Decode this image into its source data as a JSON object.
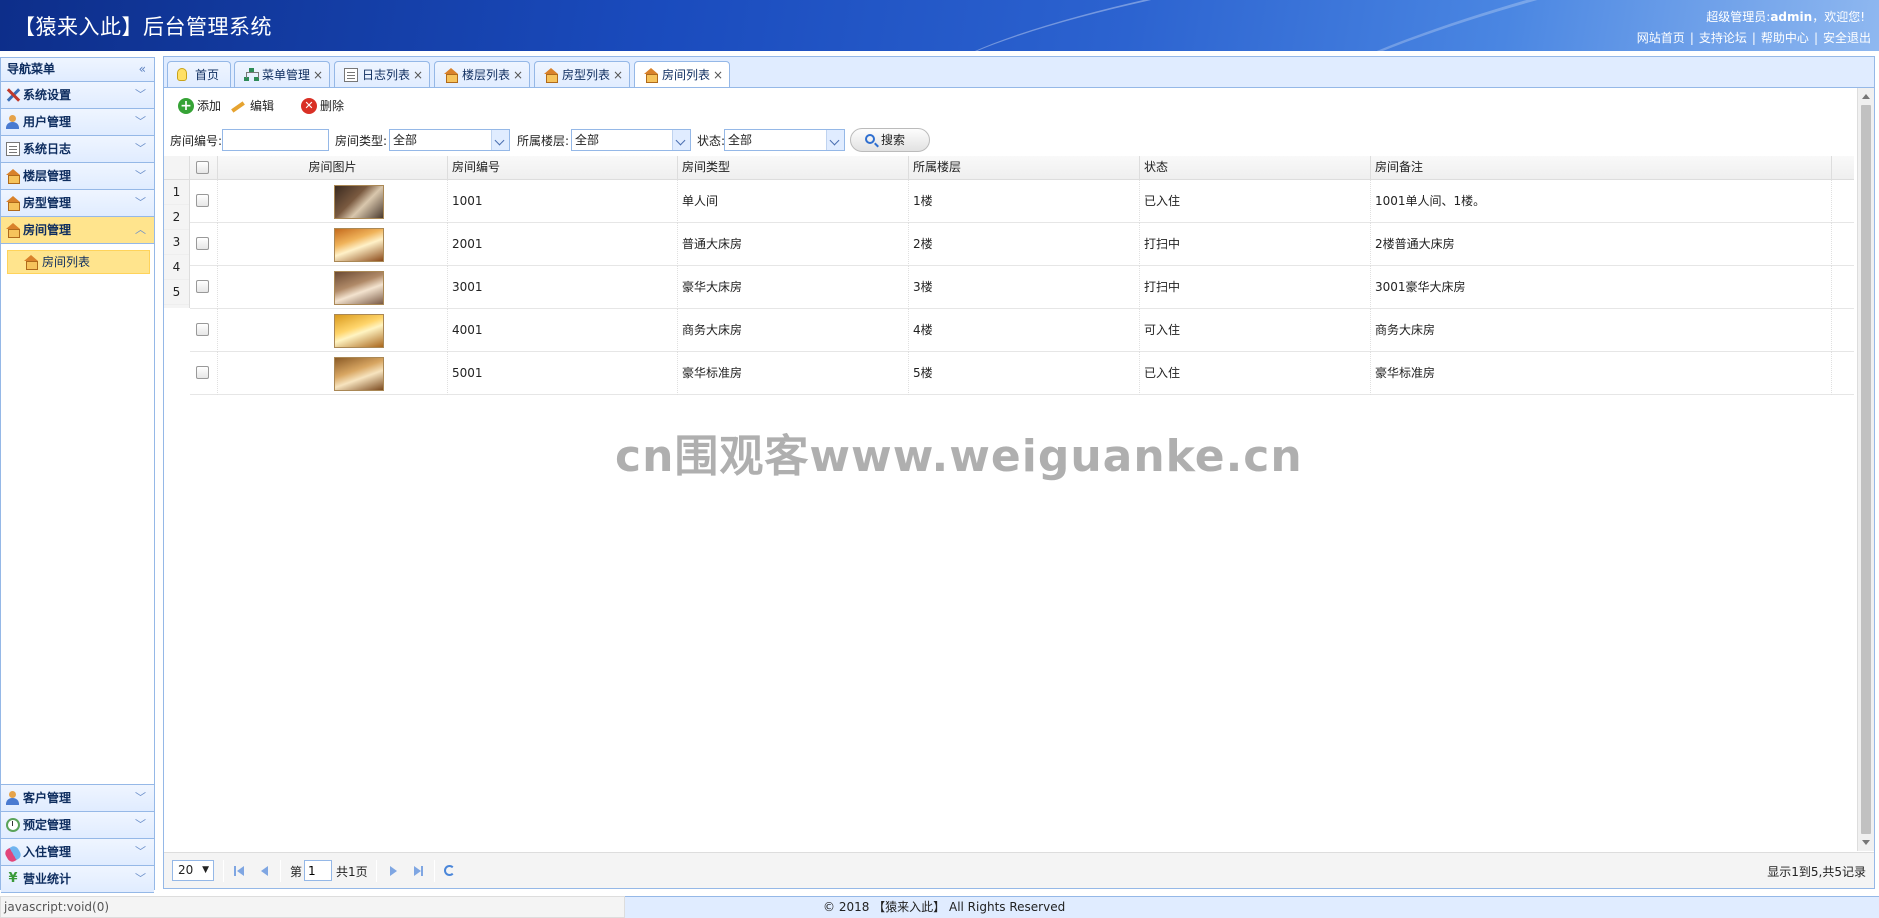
{
  "header": {
    "title": "【猿来入此】后台管理系统",
    "welcome_prefix": "超级管理员:",
    "welcome_user": "admin",
    "welcome_suffix": "，欢迎您!",
    "links": [
      "网站首页",
      "支持论坛",
      "帮助中心",
      "安全退出"
    ],
    "colors": {
      "gradient_start": "#0d2e8a",
      "gradient_end": "#8fb8f0"
    }
  },
  "sidebar": {
    "title": "导航菜单",
    "collapse_icon": "double-chevron-left-icon",
    "top_items": [
      {
        "label": "系统设置",
        "icon": "tools-icon"
      },
      {
        "label": "用户管理",
        "icon": "users-icon"
      },
      {
        "label": "系统日志",
        "icon": "log-icon"
      },
      {
        "label": "楼层管理",
        "icon": "house-icon"
      },
      {
        "label": "房型管理",
        "icon": "house-icon"
      },
      {
        "label": "房间管理",
        "icon": "house-icon",
        "active": true
      }
    ],
    "active_sub_item": {
      "label": "房间列表",
      "icon": "house-icon"
    },
    "bottom_items": [
      {
        "label": "客户管理",
        "icon": "users-icon"
      },
      {
        "label": "预定管理",
        "icon": "clock-icon"
      },
      {
        "label": "入住管理",
        "icon": "pill-icon"
      },
      {
        "label": "营业统计",
        "icon": "yen-icon"
      }
    ],
    "colors": {
      "active_bg": "#ffe48d",
      "border": "#95b8e7"
    }
  },
  "tabs": [
    {
      "label": "首页",
      "icon": "bulb-icon",
      "closable": false
    },
    {
      "label": "菜单管理",
      "icon": "tree-icon",
      "closable": true
    },
    {
      "label": "日志列表",
      "icon": "log-icon",
      "closable": true
    },
    {
      "label": "楼层列表",
      "icon": "house-icon",
      "closable": true
    },
    {
      "label": "房型列表",
      "icon": "house-icon",
      "closable": true
    },
    {
      "label": "房间列表",
      "icon": "house-icon",
      "closable": true,
      "active": true
    }
  ],
  "toolbar": {
    "add_label": "添加",
    "edit_label": "编辑",
    "delete_label": "删除"
  },
  "search": {
    "room_no_label": "房间编号:",
    "room_no_value": "",
    "room_type_label": "房间类型:",
    "room_type_value": "全部",
    "floor_label": "所属楼层:",
    "floor_value": "全部",
    "status_label": "状态:",
    "status_value": "全部",
    "search_button": "搜索"
  },
  "grid": {
    "columns": [
      "房间图片",
      "房间编号",
      "房间类型",
      "所属楼层",
      "状态",
      "房间备注"
    ],
    "row_numbers": [
      "1",
      "2",
      "3",
      "4",
      "5"
    ],
    "rows": [
      {
        "photo": "room-photo-1",
        "room_no": "1001",
        "type": "单人间",
        "floor": "1楼",
        "status": "已入住",
        "remark": "1001单人间、1楼。"
      },
      {
        "photo": "room-photo-2",
        "room_no": "2001",
        "type": "普通大床房",
        "floor": "2楼",
        "status": "打扫中",
        "remark": "2楼普通大床房"
      },
      {
        "photo": "room-photo-3",
        "room_no": "3001",
        "type": "豪华大床房",
        "floor": "3楼",
        "status": "打扫中",
        "remark": "3001豪华大床房"
      },
      {
        "photo": "room-photo-4",
        "room_no": "4001",
        "type": "商务大床房",
        "floor": "4楼",
        "status": "可入住",
        "remark": "商务大床房"
      },
      {
        "photo": "room-photo-5",
        "room_no": "5001",
        "type": "豪华标准房",
        "floor": "5楼",
        "status": "已入住",
        "remark": "豪华标准房"
      }
    ]
  },
  "watermark": "cn围观客www.weiguanke.cn",
  "pager": {
    "page_size": "20",
    "page_prefix": "第",
    "page_value": "1",
    "page_suffix": "共1页",
    "info": "显示1到5,共5记录"
  },
  "statusbar": "javascript:void(0)",
  "footer": "© 2018 【猿来入此】 All Rights Reserved"
}
